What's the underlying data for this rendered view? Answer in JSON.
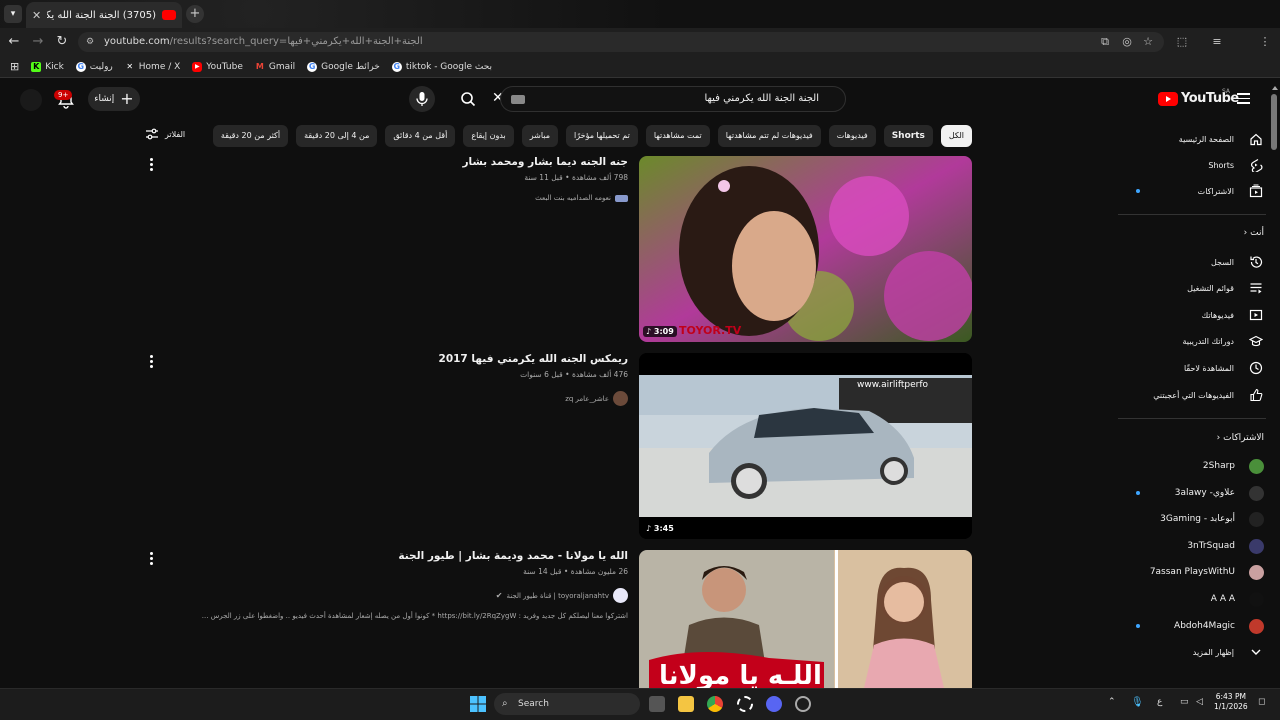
{
  "browser": {
    "tab_title": "(3705) الجنة الجنة الله يكرمني فيها",
    "url_host": "youtube.com",
    "url_path": "/results?search_query=الجنة+الجنة+الله+يكرمني+فيها",
    "bookmarks": [
      {
        "label": "Kick",
        "icon": "kick-icon",
        "color": "#53fc18"
      },
      {
        "label": "رولیت",
        "icon": "google-icon",
        "color": "#4285f4"
      },
      {
        "label": "Home / X",
        "icon": "x-icon",
        "color": "#ffffff"
      },
      {
        "label": "YouTube",
        "icon": "youtube-icon",
        "color": "#ff0000"
      },
      {
        "label": "Gmail",
        "icon": "gmail-icon",
        "color": "#ea4335"
      },
      {
        "label": "Google خرائط",
        "icon": "google-icon",
        "color": "#4285f4"
      },
      {
        "label": "tiktok - Google بحث",
        "icon": "google-icon",
        "color": "#4285f4"
      }
    ]
  },
  "header": {
    "search_value": "الجنة الجنة الله يكرمني فيها",
    "create_label": "إنشاء",
    "notif_count": "9+",
    "logo_text": "YouTube",
    "region": "SA"
  },
  "chips": [
    {
      "label": "الكل",
      "active": true
    },
    {
      "label": "Shorts",
      "bold": true
    },
    {
      "label": "فيديوهات"
    },
    {
      "label": "فيديوهات لم تتم مشاهدتها"
    },
    {
      "label": "تمت مشاهدتها"
    },
    {
      "label": "تم تحميلها مؤخرًا"
    },
    {
      "label": "مباشر"
    },
    {
      "label": "بدون إيقاع"
    },
    {
      "label": "أقل من 4 دقائق"
    },
    {
      "label": "من 4 إلى 20 دقيقة"
    },
    {
      "label": "أكثر من 20 دقيقة"
    }
  ],
  "filters_label": "الفلاتر",
  "results": [
    {
      "title": "جنه الجنه ديما بشار ومحمد بشار",
      "meta": "798 ألف مشاهدة • قبل 11 سنة",
      "channel": "نعومه الصداميه بنت البعث",
      "duration": "3:09",
      "description": ""
    },
    {
      "title": "ريمكس الجنه الله يكرمني فيها 2017",
      "meta": "476 ألف مشاهدة • قبل 6 سنوات",
      "channel": "عاشر_عامر zq",
      "duration": "3:45",
      "description": ""
    },
    {
      "title": "الله يا مولانا - محمد وديمة بشار | طيور الجنة",
      "meta": "26 مليون مشاهدة • قبل 14 سنة",
      "channel": "toyoraljanahtv | قناة طيور الجنة",
      "duration": "",
      "description": "اشتركوا معنا ليصلكم كل جديد وفريد : https://bit.ly/2RqZygW * كونوا أول من يصله إشعار لمشاهدة أحدث فيديو .. واضغطوا على زر الجرس ..."
    }
  ],
  "sidebar": {
    "main": [
      {
        "label": "الصفحة الرئيسية",
        "icon": "home-icon"
      },
      {
        "label": "Shorts",
        "icon": "shorts-icon"
      },
      {
        "label": "الاشتراكات",
        "icon": "subscriptions-icon",
        "dot": true
      }
    ],
    "you_header": "أنت",
    "you": [
      {
        "label": "السجل",
        "icon": "history-icon"
      },
      {
        "label": "قوائم التشغيل",
        "icon": "playlists-icon"
      },
      {
        "label": "فيديوهاتك",
        "icon": "your-videos-icon"
      },
      {
        "label": "دوراتك التدريبية",
        "icon": "courses-icon"
      },
      {
        "label": "المشاهدة لاحقًا",
        "icon": "watch-later-icon"
      },
      {
        "label": "الفيديوهات التي أعجبتني",
        "icon": "liked-icon"
      }
    ],
    "subs_header": "الاشتراكات",
    "subs": [
      {
        "label": "2Sharp",
        "color": "#4a8f3a",
        "dot": false
      },
      {
        "label": "علاوي- 3alawy",
        "color": "#333333",
        "dot": true
      },
      {
        "label": "أبوعابد - 3Gaming",
        "color": "#222222",
        "dot": false
      },
      {
        "label": "3nTrSquad",
        "color": "#3a3a6a",
        "dot": false
      },
      {
        "label": "7assan PlaysWithU",
        "color": "#c9a0a0",
        "dot": false
      },
      {
        "label": "A A A",
        "color": "#111111",
        "dot": false
      },
      {
        "label": "Abdoh4Magic",
        "color": "#c0392b",
        "dot": true
      }
    ],
    "show_more": "إظهار المزيد"
  },
  "taskbar": {
    "search_placeholder": "Search",
    "time": "6:43 PM",
    "date": "1/1/2026",
    "lang": "ع"
  }
}
